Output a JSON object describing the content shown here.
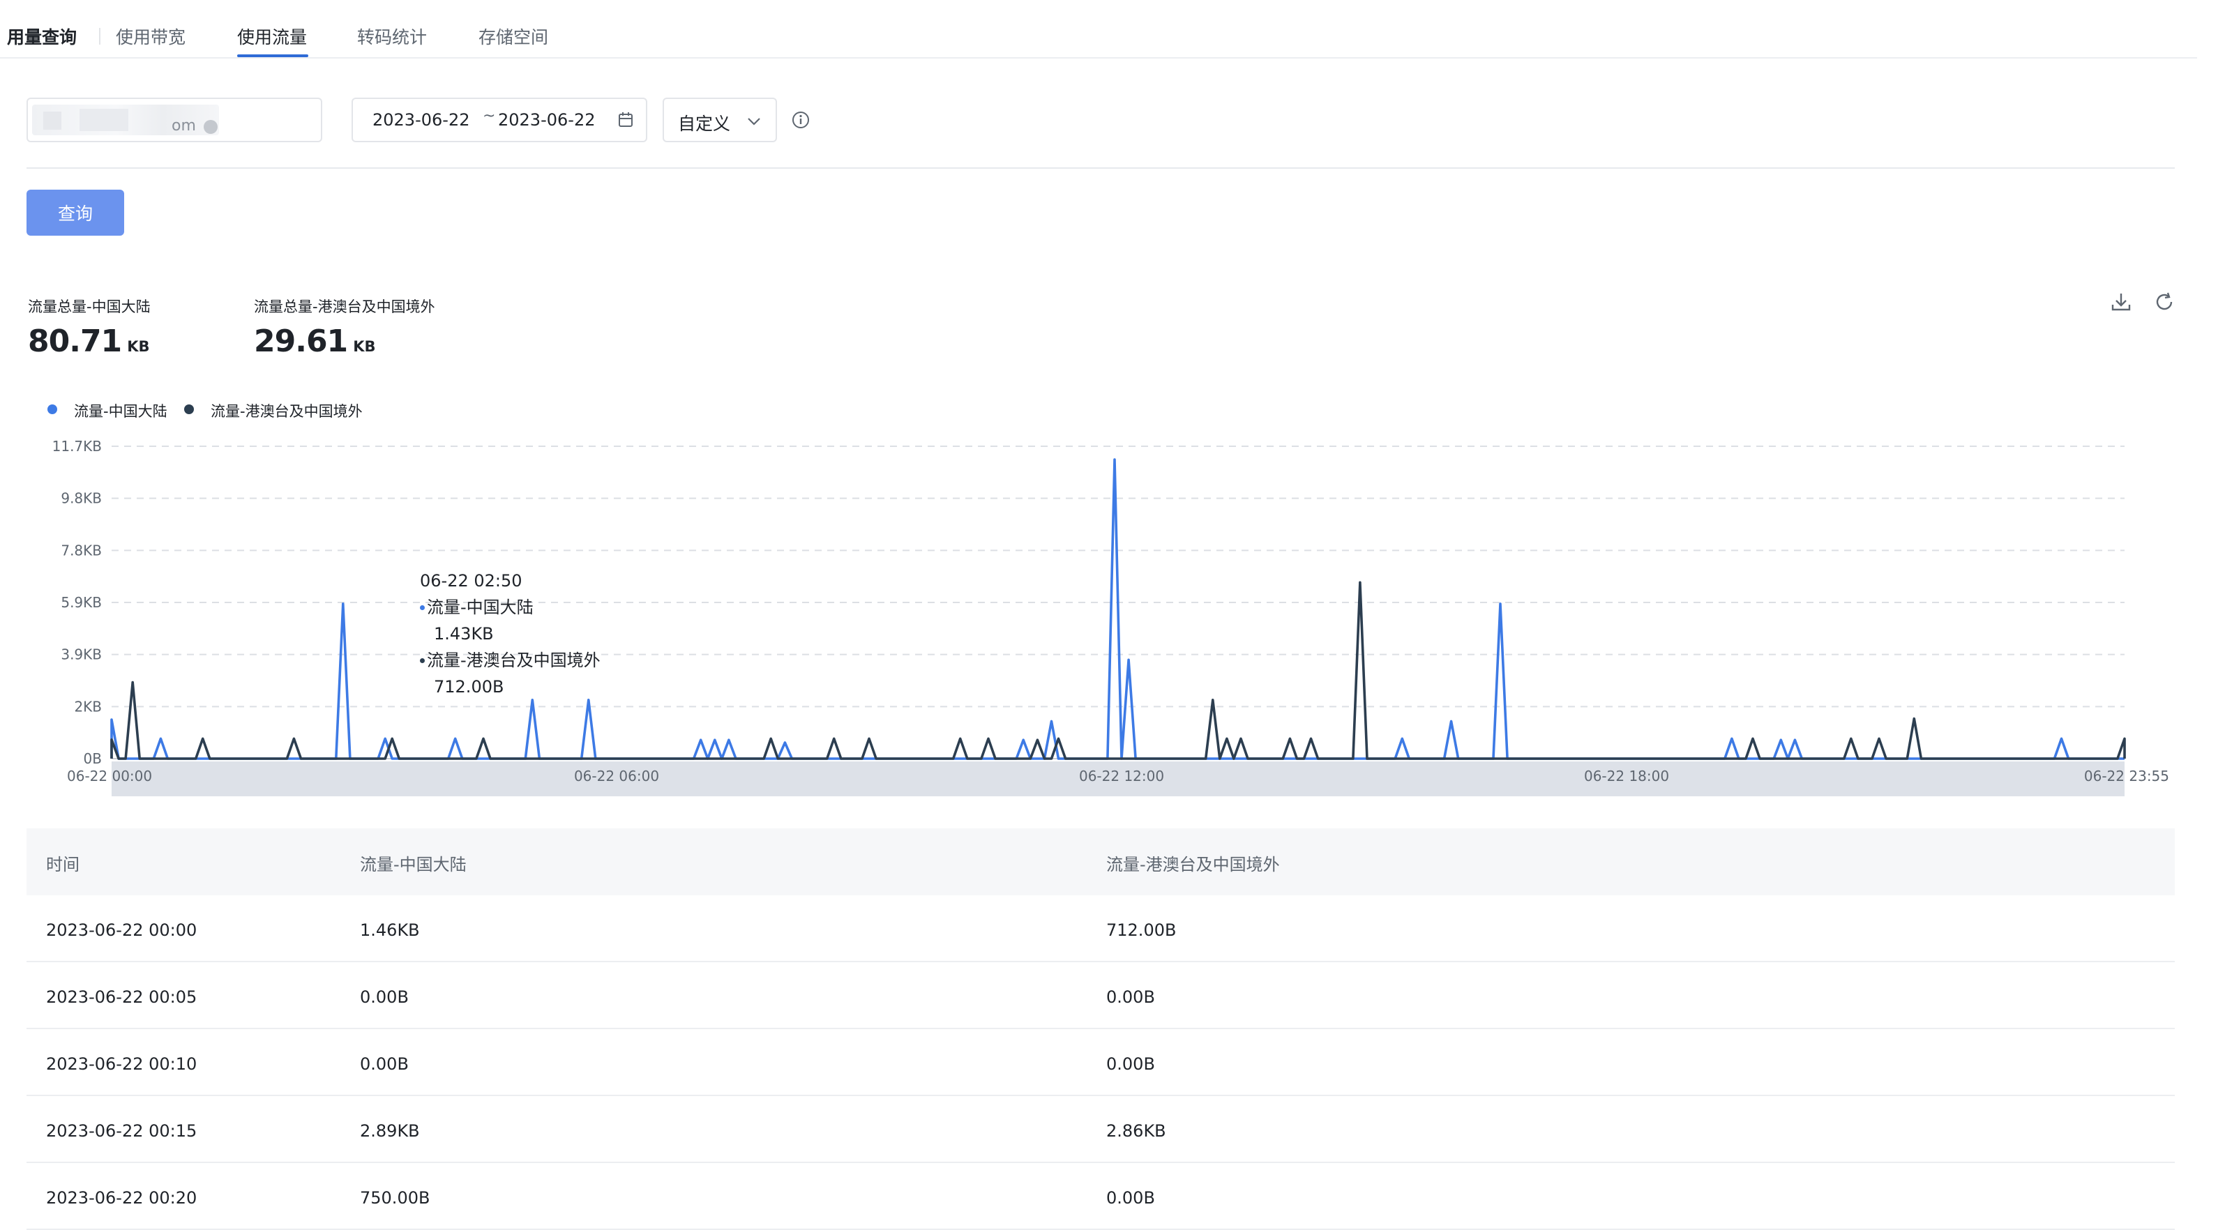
{
  "page_title": "用量查询",
  "tabs": [
    {
      "label": "使用带宽",
      "active": false
    },
    {
      "label": "使用流量",
      "active": true
    },
    {
      "label": "转码统计",
      "active": false
    },
    {
      "label": "存储空间",
      "active": false
    }
  ],
  "filters": {
    "domain_suffix": "om",
    "date_start": "2023-06-22",
    "date_separator": "~",
    "date_end": "2023-06-22",
    "preset": "自定义"
  },
  "query_button": "查询",
  "totals": [
    {
      "label": "流量总量-中国大陆",
      "value": "80.71",
      "unit": "KB"
    },
    {
      "label": "流量总量-港澳台及中国境外",
      "value": "29.61",
      "unit": "KB"
    }
  ],
  "tooltip": {
    "time": "06-22 02:50",
    "rows": [
      {
        "name": "流量-中国大陆",
        "value": "1.43KB"
      },
      {
        "name": "流量-港澳台及中国境外",
        "value": "712.00B"
      }
    ]
  },
  "colors": {
    "mainland": "#3d7ae5",
    "overseas": "#2c3e50",
    "primary_button": "#6b93ee",
    "active_tab": "#2f6bd6"
  },
  "chart_data": {
    "type": "line",
    "y_ticks": [
      "0B",
      "2KB",
      "3.9KB",
      "5.9KB",
      "7.8KB",
      "9.8KB",
      "11.7KB"
    ],
    "x_ticks": [
      "06-22 00:00",
      "06-22 06:00",
      "06-22 12:00",
      "06-22 18:00",
      "06-22 23:55"
    ],
    "x_unit": "minutes since 06-22 00:00",
    "y_unit": "KB",
    "ylim": [
      0,
      11.7
    ],
    "xlim": [
      0,
      1435
    ],
    "grid": true,
    "legend_position": "top-left",
    "series": [
      {
        "name": "流量-中国大陆",
        "peaks": [
          [
            0,
            1.46
          ],
          [
            35,
            0.75
          ],
          [
            165,
            5.8
          ],
          [
            195,
            0.75
          ],
          [
            245,
            0.75
          ],
          [
            300,
            2.2
          ],
          [
            340,
            2.2
          ],
          [
            420,
            0.7
          ],
          [
            430,
            0.7
          ],
          [
            440,
            0.7
          ],
          [
            480,
            0.6
          ],
          [
            650,
            0.7
          ],
          [
            670,
            1.4
          ],
          [
            715,
            11.2
          ],
          [
            725,
            3.7
          ],
          [
            920,
            0.75
          ],
          [
            955,
            1.4
          ],
          [
            990,
            5.8
          ],
          [
            1155,
            0.75
          ],
          [
            1190,
            0.7
          ],
          [
            1200,
            0.7
          ],
          [
            1390,
            0.75
          ]
        ]
      },
      {
        "name": "流量-港澳台及中国境外",
        "peaks": [
          [
            0,
            0.71
          ],
          [
            15,
            2.86
          ],
          [
            65,
            0.75
          ],
          [
            130,
            0.75
          ],
          [
            200,
            0.75
          ],
          [
            265,
            0.75
          ],
          [
            470,
            0.75
          ],
          [
            515,
            0.75
          ],
          [
            540,
            0.75
          ],
          [
            605,
            0.75
          ],
          [
            625,
            0.75
          ],
          [
            660,
            0.7
          ],
          [
            675,
            0.75
          ],
          [
            785,
            2.2
          ],
          [
            795,
            0.75
          ],
          [
            805,
            0.75
          ],
          [
            840,
            0.75
          ],
          [
            855,
            0.75
          ],
          [
            890,
            6.6
          ],
          [
            1170,
            0.75
          ],
          [
            1240,
            0.75
          ],
          [
            1260,
            0.75
          ],
          [
            1285,
            1.5
          ],
          [
            1435,
            0.75
          ]
        ]
      }
    ]
  },
  "table": {
    "columns": [
      "时间",
      "流量-中国大陆",
      "流量-港澳台及中国境外"
    ],
    "rows": [
      [
        "2023-06-22 00:00",
        "1.46KB",
        "712.00B"
      ],
      [
        "2023-06-22 00:05",
        "0.00B",
        "0.00B"
      ],
      [
        "2023-06-22 00:10",
        "0.00B",
        "0.00B"
      ],
      [
        "2023-06-22 00:15",
        "2.89KB",
        "2.86KB"
      ],
      [
        "2023-06-22 00:20",
        "750.00B",
        "0.00B"
      ]
    ]
  }
}
